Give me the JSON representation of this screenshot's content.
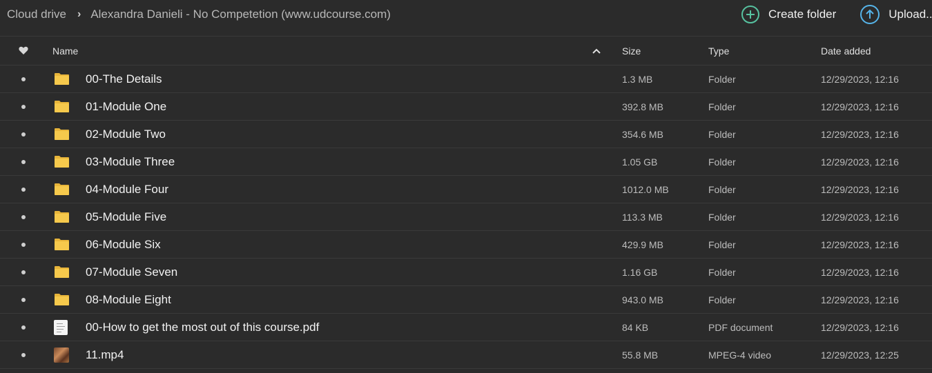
{
  "breadcrumb": {
    "root": "Cloud drive",
    "current": "Alexandra Danieli - No Competetion (www.udcourse.com)"
  },
  "actions": {
    "create_folder": "Create folder",
    "upload": "Upload..."
  },
  "colors": {
    "background": "#2b2b2b",
    "accent_icon": "#57c2a0",
    "upload_icon": "#56b4e9",
    "folder": "#f6c94c"
  },
  "columns": {
    "favorite_icon": "heart-icon",
    "name": "Name",
    "size": "Size",
    "type": "Type",
    "date_added": "Date added",
    "sort_indicator": "chevron-up-icon"
  },
  "rows": [
    {
      "icon": "folder-icon",
      "name": "00-The Details",
      "size": "1.3 MB",
      "type": "Folder",
      "date": "12/29/2023, 12:16"
    },
    {
      "icon": "folder-icon",
      "name": "01-Module One",
      "size": "392.8 MB",
      "type": "Folder",
      "date": "12/29/2023, 12:16"
    },
    {
      "icon": "folder-icon",
      "name": "02-Module Two",
      "size": "354.6 MB",
      "type": "Folder",
      "date": "12/29/2023, 12:16"
    },
    {
      "icon": "folder-icon",
      "name": "03-Module Three",
      "size": "1.05 GB",
      "type": "Folder",
      "date": "12/29/2023, 12:16"
    },
    {
      "icon": "folder-icon",
      "name": "04-Module Four",
      "size": "1012.0 MB",
      "type": "Folder",
      "date": "12/29/2023, 12:16"
    },
    {
      "icon": "folder-icon",
      "name": "05-Module Five",
      "size": "113.3 MB",
      "type": "Folder",
      "date": "12/29/2023, 12:16"
    },
    {
      "icon": "folder-icon",
      "name": "06-Module Six",
      "size": "429.9 MB",
      "type": "Folder",
      "date": "12/29/2023, 12:16"
    },
    {
      "icon": "folder-icon",
      "name": "07-Module Seven",
      "size": "1.16 GB",
      "type": "Folder",
      "date": "12/29/2023, 12:16"
    },
    {
      "icon": "folder-icon",
      "name": "08-Module Eight",
      "size": "943.0 MB",
      "type": "Folder",
      "date": "12/29/2023, 12:16"
    },
    {
      "icon": "pdf-icon",
      "name": "00-How to get the most out of this course.pdf",
      "size": "84 KB",
      "type": "PDF document",
      "date": "12/29/2023, 12:16"
    },
    {
      "icon": "video-thumbnail-icon",
      "name": "11.mp4",
      "size": "55.8 MB",
      "type": "MPEG-4 video",
      "date": "12/29/2023, 12:25"
    }
  ]
}
